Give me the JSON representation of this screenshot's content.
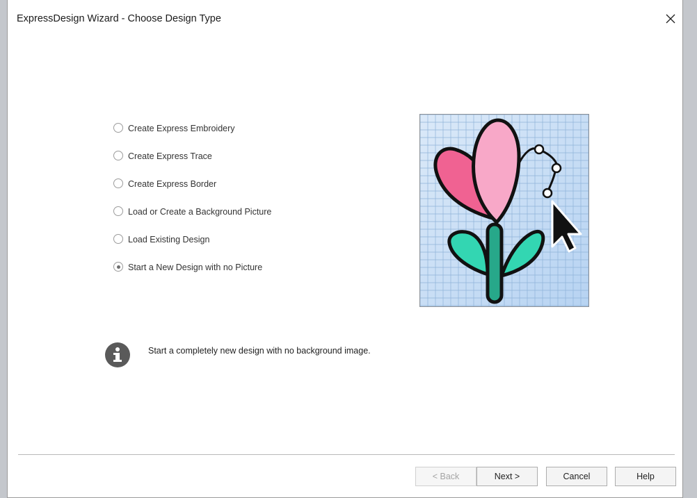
{
  "window": {
    "title": "ExpressDesign Wizard - Choose Design Type",
    "close_icon": "close-icon"
  },
  "options": [
    {
      "label": "Create Express Embroidery",
      "selected": false
    },
    {
      "label": "Create Express Trace",
      "selected": false
    },
    {
      "label": "Create Express Border",
      "selected": false
    },
    {
      "label": "Load or Create a Background Picture",
      "selected": false
    },
    {
      "label": "Load Existing Design",
      "selected": false
    },
    {
      "label": "Start a New Design with no Picture",
      "selected": true
    }
  ],
  "info": {
    "icon": "info-icon",
    "text": "Start a completely new design with no background image."
  },
  "buttons": {
    "back": "< Back",
    "next": "Next >",
    "cancel": "Cancel",
    "help": "Help"
  },
  "colors": {
    "petal_left": "#f06292",
    "petal_right": "#f8a8c8",
    "leaf": "#33d6b2",
    "stem": "#27a88a",
    "grid_bg": "#cfe1f6",
    "grid_line": "#8fb3d9"
  }
}
